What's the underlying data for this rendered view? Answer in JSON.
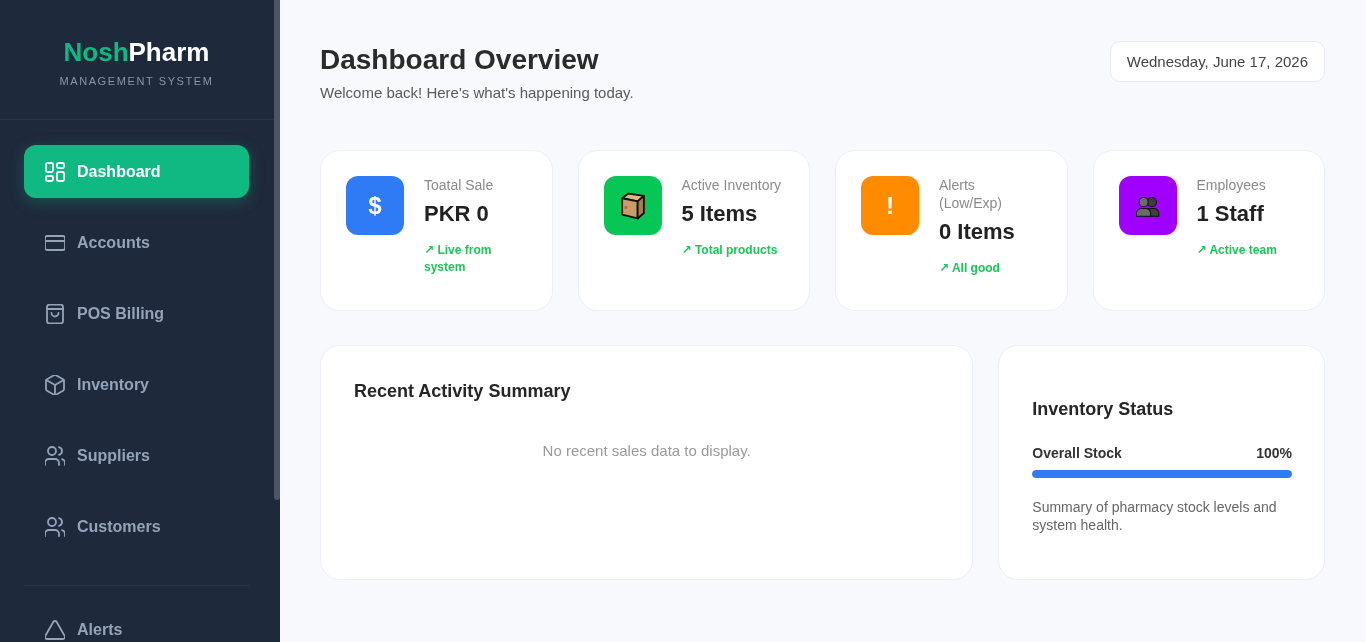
{
  "sidebar": {
    "brand": {
      "parts": [
        {
          "text": "Nosh",
          "kind": "accent"
        },
        {
          "text": "Pharm",
          "kind": "plain"
        }
      ],
      "tagline": "MANAGEMENT SYSTEM"
    },
    "main_items": [
      {
        "label": "Dashboard",
        "kind": "dashboard",
        "selected": true
      },
      {
        "label": "Accounts",
        "kind": "accounts",
        "selected": false
      },
      {
        "label": "POS Billing",
        "kind": "billing",
        "selected": false
      },
      {
        "label": "Inventory",
        "kind": "inventory",
        "selected": false
      },
      {
        "label": "Suppliers",
        "kind": "suppliers",
        "selected": false
      },
      {
        "label": "Customers",
        "kind": "customers",
        "selected": false
      }
    ],
    "bottom_items": [
      {
        "label": "Alerts",
        "kind": "alerts",
        "selected": false
      }
    ]
  },
  "header": {
    "title": "Dashboard Overview",
    "subtitle": "Welcome back! Here's what's happening today.",
    "date": "Wednesday, June 17, 2026"
  },
  "stats": [
    {
      "kind": "currency",
      "glyph": "$",
      "color": "#2f7bf6",
      "label": "Toatal Sale",
      "value": "PKR 0",
      "trend": "↗ Live from system"
    },
    {
      "kind": "package",
      "color": "#06c755",
      "label": "Active Inventory",
      "value": "5 Items",
      "trend": "↗ Total products"
    },
    {
      "kind": "warning",
      "glyph": "!",
      "color": "#ff8c00",
      "label": "Alerts (Low/Exp)",
      "value": "0 Items",
      "trend": "↗ All good"
    },
    {
      "kind": "people",
      "color": "#a000ff",
      "label": "Employees",
      "value": "1 Staff",
      "trend": "↗ Active team"
    }
  ],
  "recent_activity": {
    "title": "Recent Activity Summary",
    "empty_message": "No recent sales data to display."
  },
  "inventory_status": {
    "title": "Inventory Status",
    "metric": {
      "label": "Overall Stock",
      "reading": "100%",
      "level": 1
    },
    "description": "Summary of pharmacy stock levels and system health."
  }
}
